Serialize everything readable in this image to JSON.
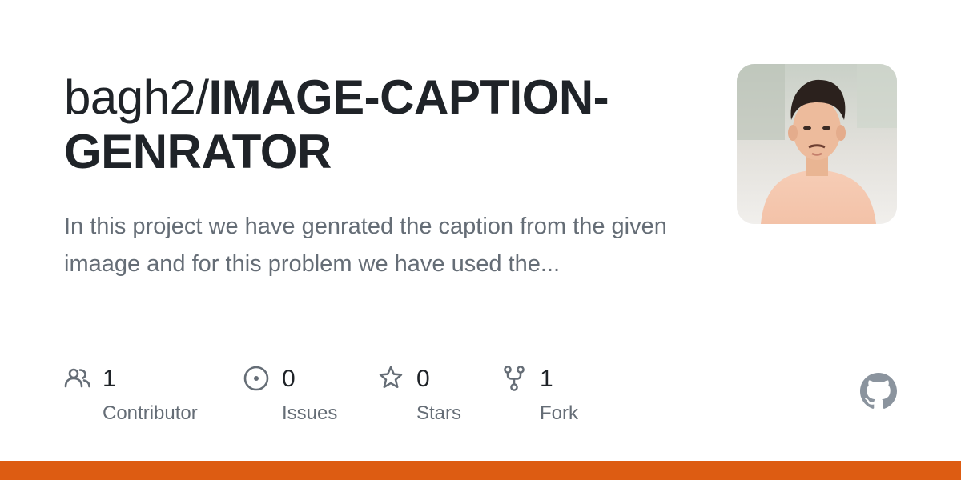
{
  "repo": {
    "owner_prefix": "bagh2/",
    "name": "IMAGE-CAPTION-GENRATOR"
  },
  "description": "In this project we have genrated the caption from the given imaage and for this problem we have used the...",
  "stats": [
    {
      "icon": "people-icon",
      "count": "1",
      "label": "Contributor"
    },
    {
      "icon": "issue-icon",
      "count": "0",
      "label": "Issues"
    },
    {
      "icon": "star-icon",
      "count": "0",
      "label": "Stars"
    },
    {
      "icon": "fork-icon",
      "count": "1",
      "label": "Fork"
    }
  ],
  "colors": {
    "title": "#1f2328",
    "muted": "#656d76",
    "language_bar": "#dd5c12",
    "github_logo": "#8b949e"
  },
  "icons": {
    "avatar": "owner-avatar",
    "logo": "github-logo-icon"
  }
}
